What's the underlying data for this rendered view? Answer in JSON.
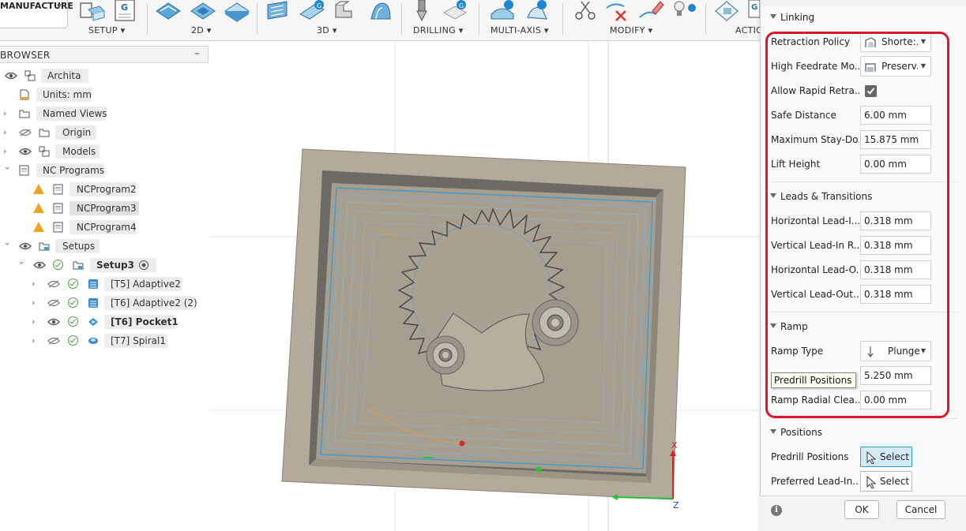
{
  "toolbar": {
    "workspace": "MANUFACTURE",
    "workspace_arrow": "▾",
    "groups": [
      {
        "label": "SETUP ▾"
      },
      {
        "label": "2D ▾"
      },
      {
        "label": "3D ▾"
      },
      {
        "label": "DRILLING ▾"
      },
      {
        "label": "MULTI-AXIS ▾"
      },
      {
        "label": "MODIFY ▾"
      },
      {
        "label": "ACTIO"
      }
    ]
  },
  "browser": {
    "title": "BROWSER",
    "minimize": "–",
    "items": [
      {
        "label": "Archita"
      },
      {
        "label": "Units: mm"
      },
      {
        "label": "Named Views"
      },
      {
        "label": "Origin"
      },
      {
        "label": "Models"
      },
      {
        "label": "NC Programs"
      },
      {
        "label": "NCProgram2"
      },
      {
        "label": "NCProgram3"
      },
      {
        "label": "NCProgram4"
      },
      {
        "label": "Setups"
      },
      {
        "label": "Setup3"
      },
      {
        "label": "[T5] Adaptive2"
      },
      {
        "label": "[T6] Adaptive2 (2)"
      },
      {
        "label": "[T6] Pocket1"
      },
      {
        "label": "[T7] Spiral1"
      }
    ]
  },
  "panel": {
    "linking": {
      "title": "Linking",
      "retraction_policy": {
        "label": "Retraction Policy",
        "value": "Shorte:..."
      },
      "high_feedrate": {
        "label": "High Feedrate Mo...",
        "value": "Preserv..."
      },
      "allow_rapid": {
        "label": "Allow Rapid Retra...",
        "checked": true
      },
      "safe_distance": {
        "label": "Safe Distance",
        "value": "6.00 mm"
      },
      "max_stay_down": {
        "label": "Maximum Stay-Do...",
        "value": "15.875 mm"
      },
      "lift_height": {
        "label": "Lift Height",
        "value": "0.00 mm"
      }
    },
    "leads": {
      "title": "Leads & Transitions",
      "h_lead_in": {
        "label": "Horizontal Lead-I...",
        "value": "0.318 mm"
      },
      "v_lead_in": {
        "label": "Vertical Lead-In R...",
        "value": "0.318 mm"
      },
      "h_lead_out": {
        "label": "Horizontal Lead-O...",
        "value": "0.318 mm"
      },
      "v_lead_out": {
        "label": "Vertical Lead-Out...",
        "value": "0.318 mm"
      }
    },
    "ramp": {
      "title": "Ramp",
      "ramp_type": {
        "label": "Ramp Type",
        "value": "Plunge"
      },
      "ramp_clearance": {
        "value": "5.250 mm"
      },
      "ramp_radial": {
        "label": "Ramp Radial Clea...",
        "value": "0.00 mm"
      }
    },
    "positions": {
      "title": "Positions",
      "predrill": {
        "label": "Predrill Positions",
        "button": "Select"
      },
      "preferred": {
        "label": "Preferred Lead-In...",
        "button": "Select"
      }
    },
    "tooltip": "Predrill Positions",
    "ok": "OK",
    "cancel": "Cancel",
    "info": "i"
  },
  "viewport": {
    "axis_x": "X",
    "axis_z": "Z"
  },
  "colors": {
    "accent": "#2f9bd4",
    "highlight_box": "#e0162b",
    "warning": "#f0a020",
    "toolpath": "#3a9ad6",
    "stock": "#b3aa9b"
  }
}
